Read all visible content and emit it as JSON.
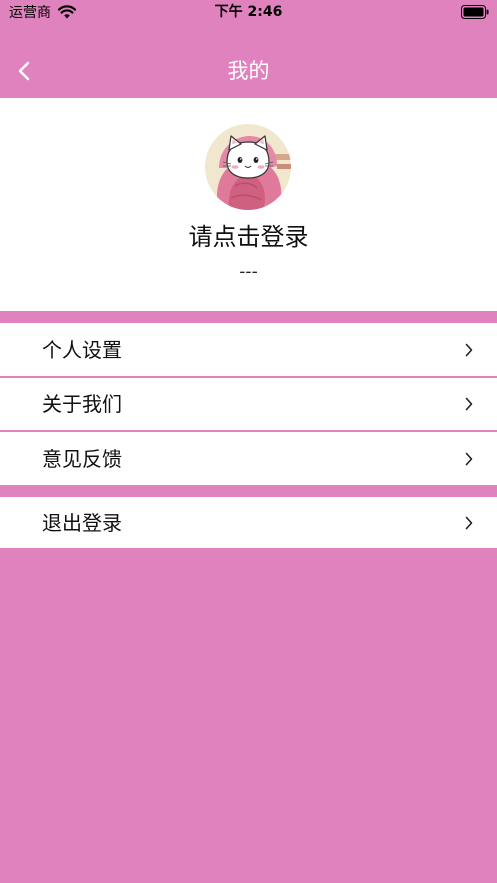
{
  "status_bar": {
    "carrier": "运营商",
    "time": "下午 2:46"
  },
  "nav": {
    "title": "我的"
  },
  "profile": {
    "login_prompt": "请点击登录",
    "subtitle": "---"
  },
  "menu": {
    "items": [
      {
        "label": "个人设置"
      },
      {
        "label": "关于我们"
      },
      {
        "label": "意见反馈"
      }
    ],
    "logout_label": "退出登录"
  },
  "colors": {
    "accent": "#DF82BD",
    "card": "#FFFFFF"
  }
}
